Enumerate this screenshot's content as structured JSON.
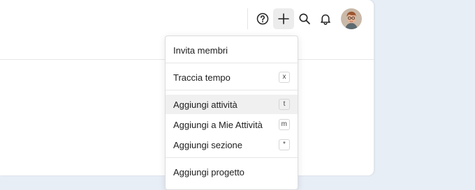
{
  "toolbar": {
    "help_icon": "question-circle-icon",
    "add_icon": "plus-icon",
    "search_icon": "search-icon",
    "notifications_icon": "bell-icon",
    "avatar_icon": "user-avatar"
  },
  "menu": {
    "items": [
      {
        "label": "Invita membri",
        "shortcut": ""
      },
      {
        "label": "Traccia tempo",
        "shortcut": "x"
      },
      {
        "label": "Aggiungi attività",
        "shortcut": "t"
      },
      {
        "label": "Aggiungi a Mie Attività",
        "shortcut": "m"
      },
      {
        "label": "Aggiungi sezione",
        "shortcut": "*"
      },
      {
        "label": "Aggiungi progetto",
        "shortcut": ""
      }
    ]
  },
  "colors": {
    "background": "#e8eef6",
    "panel": "#ffffff",
    "hover": "#f0f0f0"
  }
}
